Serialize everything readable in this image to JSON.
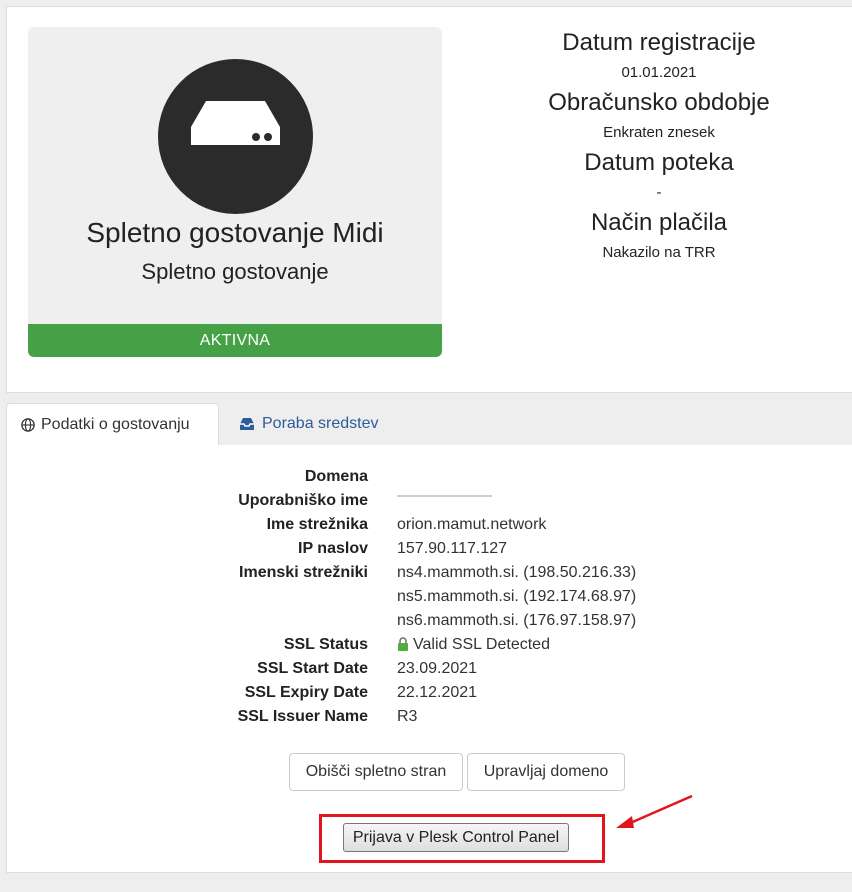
{
  "product": {
    "name": "Spletno gostovanje Midi",
    "group": "Spletno gostovanje",
    "status": "AKTIVNA",
    "icon": "server-icon"
  },
  "info": {
    "registration_label": "Datum registracije",
    "registration_value": "01.01.2021",
    "billing_label": "Obračunsko obdobje",
    "billing_value": "Enkraten znesek",
    "due_label": "Datum poteka",
    "due_value": "-",
    "payment_label": "Način plačila",
    "payment_value": "Nakazilo na TRR"
  },
  "tabs": [
    {
      "label": "Podatki o gostovanju",
      "icon": "globe-icon"
    },
    {
      "label": "Poraba sredstev",
      "icon": "inbox-icon"
    }
  ],
  "details": {
    "domain_label": "Domena",
    "domain_value": "",
    "username_label": "Uporabniško ime",
    "username_value": "",
    "hostname_label": "Ime strežnika",
    "hostname_value": "orion.mamut.network",
    "ip_label": "IP naslov",
    "ip_value": "157.90.117.127",
    "ns_label": "Imenski strežniki",
    "ns": [
      "ns4.mammoth.si. (198.50.216.33)",
      "ns5.mammoth.si. (192.174.68.97)",
      "ns6.mammoth.si. (176.97.158.97)"
    ],
    "ssl_status_label": "SSL Status",
    "ssl_status_value": "Valid SSL Detected",
    "ssl_start_label": "SSL Start Date",
    "ssl_start_value": "23.09.2021",
    "ssl_expiry_label": "SSL Expiry Date",
    "ssl_expiry_value": "22.12.2021",
    "ssl_issuer_label": "SSL Issuer Name",
    "ssl_issuer_value": "R3"
  },
  "buttons": {
    "visit": "Obišči spletno stran",
    "manage_domain": "Upravljaj domeno",
    "plesk": "Prijava v Plesk Control Panel"
  },
  "colors": {
    "status_green": "#46a046",
    "link_blue": "#2a5d99",
    "annotation_red": "#e0161c"
  }
}
